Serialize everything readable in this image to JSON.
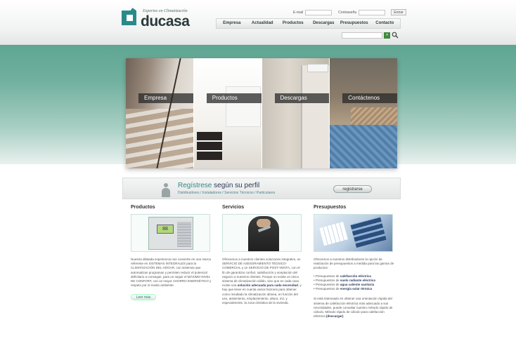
{
  "header": {
    "logo_tagline": "Expertos en Climatización",
    "logo_word": "ducasa",
    "login": {
      "email_label": "E-mail",
      "password_label": "Contraseña",
      "submit": "Entrar"
    },
    "nav": [
      "Empresa",
      "Actualidad",
      "Productos",
      "Descargas",
      "Presupuestos",
      "Contacto"
    ],
    "search": {
      "go": "»"
    }
  },
  "hero": {
    "panels": [
      "Empresa",
      "Productos",
      "Descargas",
      "Contáctenos"
    ]
  },
  "register": {
    "title_a": "Regístrese",
    "title_b": "según su perfil",
    "subtitle": "Distribuidores / Instaladores / Servicios Técnicos / Particulares",
    "button": "registrarse"
  },
  "columns": {
    "productos": {
      "title": "Productos",
      "device_display": "88",
      "text": "Nuestra dilatada experiencia nos convierte en una marca referente en SISTEMAS INTEGRALES para la CLIMATIZACIÓN DEL HOGAR, con sistemas que automatizan programan y permiten reducir el potencial deficitario a conseguir, para un seguir el MÁXIMO NIVEL DE CONFORT, con un mayor AHORRO ENERGÉTICO y respeto por el medio ambiente.",
      "more": "Leer más"
    },
    "servicios": {
      "title": "Servicios",
      "text": "Ofrecemos a nuestros clientes soluciones integrales, un SERVICIO DE ASESORAMIENTO TÉCNICO-COMERCIAL y un SERVICIO DE POST-VENTA, con el fin de garantizar confort, satisfacción y aceptación del negocio a nuestros clientes. Porque no existe un único sistema de climatización válido, sino que en cada caso existe una",
      "highlight": "solución adecuada para cada necesidad",
      "text_end": ", y hay que tener en cuenta varios factores para obtener como resultado la climatización idónea, en función del uso, aislamiento, emplazamiento, altura, m2, y especialmente, la zona climática de la vivienda."
    },
    "presupuestos": {
      "title": "Presupuestos",
      "intro": "Ofrecemos a nuestros distribuidores la opción de realización de presupuestos a medida para las gamas de productos:",
      "items": [
        {
          "prefix": "• Presupuestos de",
          "bold": "calefacción eléctrica"
        },
        {
          "prefix": "• Presupuestos de",
          "bold": "suelo radiante eléctrico"
        },
        {
          "prefix": "• Presupuestos de",
          "bold": "agua caliente sanitaria"
        },
        {
          "prefix": "• Presupuestos de",
          "bold": "energía solar térmica"
        }
      ],
      "outro": "Si está interesado en obtener una orientación rápida del sistema de calefacción eléctrica más adecuado a sus necesidades, puede consultar nuestro método rápido de cálculo. Método rápido de cálculo para calefacción eléctrica",
      "outro_bold": "(descargar)"
    }
  }
}
